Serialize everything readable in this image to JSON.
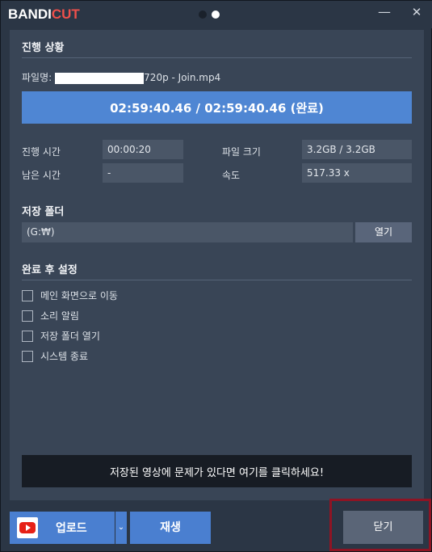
{
  "titlebar": {
    "logo_part1": "BANDI",
    "logo_part2": "CUT",
    "minimize_glyph": "—",
    "close_glyph": "✕"
  },
  "progress_section": {
    "title": "진행 상황",
    "filename_label": "파일명:",
    "filename_suffix": "720p - Join.mp4",
    "progress_text": "02:59:40.46 / 02:59:40.46 (완료)",
    "progress_fraction": 1.0
  },
  "stats": {
    "elapsed_label": "진행 시간",
    "elapsed_value": "00:00:20",
    "remaining_label": "남은 시간",
    "remaining_value": "-",
    "filesize_label": "파일 크기",
    "filesize_value": "3.2GB / 3.2GB",
    "speed_label": "속도",
    "speed_value": "517.33 x"
  },
  "save_folder": {
    "title": "저장 폴더",
    "path": "(G:₩)",
    "open_button": "열기"
  },
  "after_complete": {
    "title": "완료 후 설정",
    "options": [
      {
        "label": "메인 화면으로 이동",
        "checked": false
      },
      {
        "label": "소리 알림",
        "checked": false
      },
      {
        "label": "저장 폴더 열기",
        "checked": false
      },
      {
        "label": "시스템 종료",
        "checked": false
      }
    ]
  },
  "notice": "저장된 영상에 문제가 있다면 여기를 클릭하세요!",
  "bottom": {
    "upload_label": "업로드",
    "dropdown_glyph": "⌄",
    "play_label": "재생",
    "close_label": "닫기"
  },
  "colors": {
    "background": "#2b3645",
    "panel": "#394556",
    "accent": "#4a7fd0",
    "progress": "#4f86d3",
    "logo_red": "#f0504b",
    "highlight_frame": "#8e1424"
  }
}
